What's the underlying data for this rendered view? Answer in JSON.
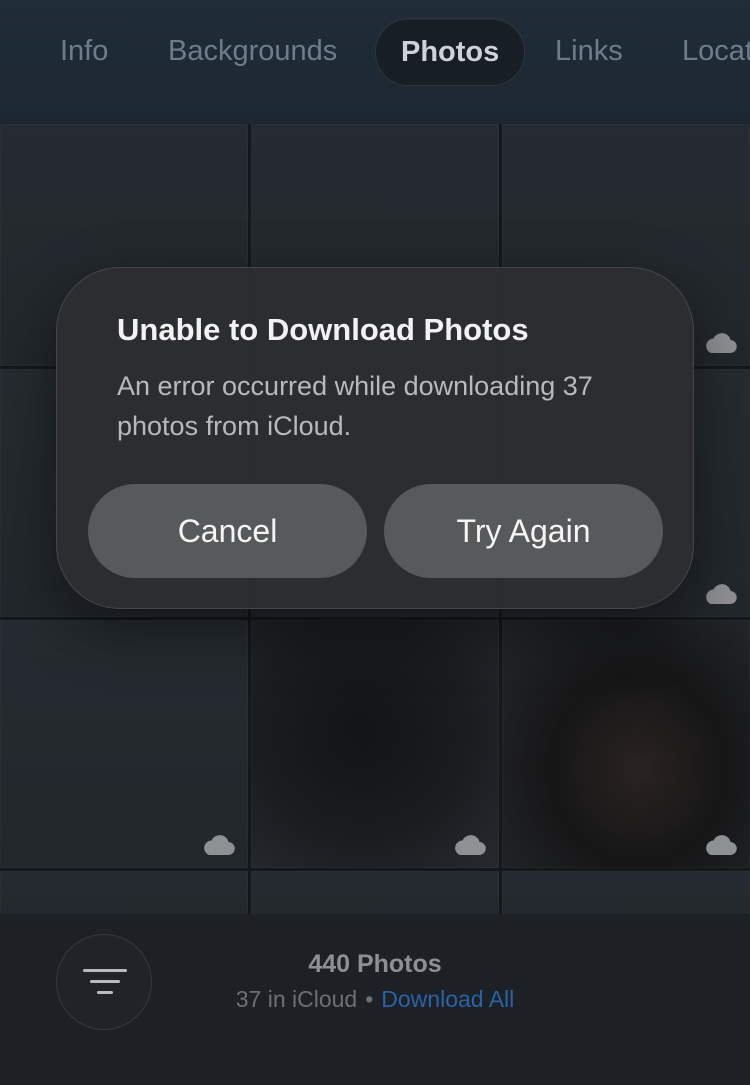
{
  "tabs": [
    {
      "label": "Info",
      "active": false
    },
    {
      "label": "Backgrounds",
      "active": false
    },
    {
      "label": "Photos",
      "active": true
    },
    {
      "label": "Links",
      "active": false
    },
    {
      "label": "Location",
      "active": false
    }
  ],
  "grid": {
    "cloud_icon": "icloud-cloud-icon"
  },
  "alert": {
    "title": "Unable to Download Photos",
    "message": "An error occurred while downloading 37 photos from iCloud.",
    "cancel_label": "Cancel",
    "retry_label": "Try Again"
  },
  "footer": {
    "filter_icon": "filter-lines-icon",
    "photo_count": "440 Photos",
    "icloud_count": "37 in iCloud",
    "separator": "•",
    "download_all_label": "Download All",
    "link_color": "#2a62a8"
  }
}
